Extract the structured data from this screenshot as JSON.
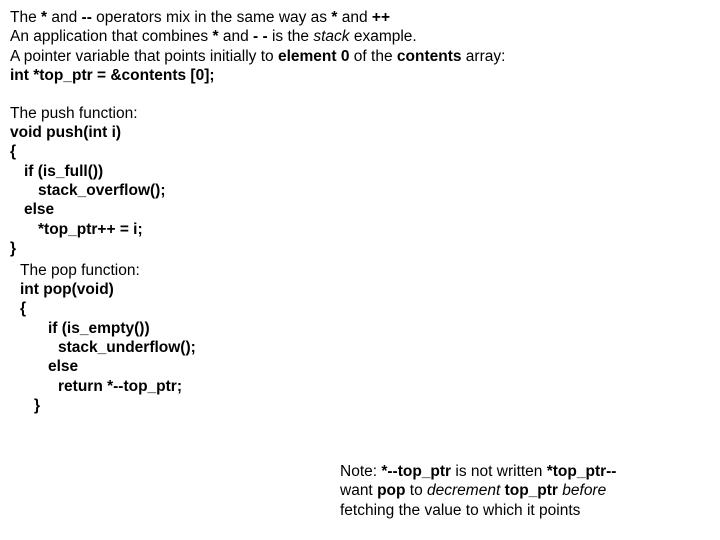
{
  "intro": {
    "l1a": "The ",
    "l1b": "*",
    "l1c": " and ",
    "l1d": "--",
    "l1e": " operators mix in the same way as ",
    "l1f": "*",
    "l1g": " and ",
    "l1h": "++",
    "l2a": "An application that combines ",
    "l2b": "*",
    "l2c": " and ",
    "l2d": "- -",
    "l2e": " is the ",
    "l2f": "stack",
    "l2g": " example.",
    "l3a": "A pointer variable that points initially to ",
    "l3b": "element 0",
    "l3c": " of the ",
    "l3d": "contents",
    "l3e": " array:",
    "l4": "int *top_ptr = &contents [0];"
  },
  "push": {
    "title": "The push function:",
    "l1": "void push(int i)",
    "l2": "{",
    "l3": "if (is_full())",
    "l4": "stack_overflow();",
    "l5": "else",
    "l6": "*top_ptr++ = i;",
    "l7": "}"
  },
  "pop": {
    "title": "The pop function:",
    "l1": "int pop(void)",
    "l2": "{",
    "l3": "if (is_empty())",
    "l4": "stack_underflow();",
    "l5": "else",
    "l6": "return *--top_ptr;",
    "l7": "}"
  },
  "note": {
    "a": "Note: ",
    "b": "*--top_ptr",
    "c": " is not written ",
    "d": "*top_ptr--",
    "e": "want ",
    "f": "pop",
    "g": " to ",
    "h": "decrement",
    "i": " ",
    "j": "top_ptr",
    "k": " ",
    "l": "before",
    "m": "fetching the value to which it points"
  }
}
